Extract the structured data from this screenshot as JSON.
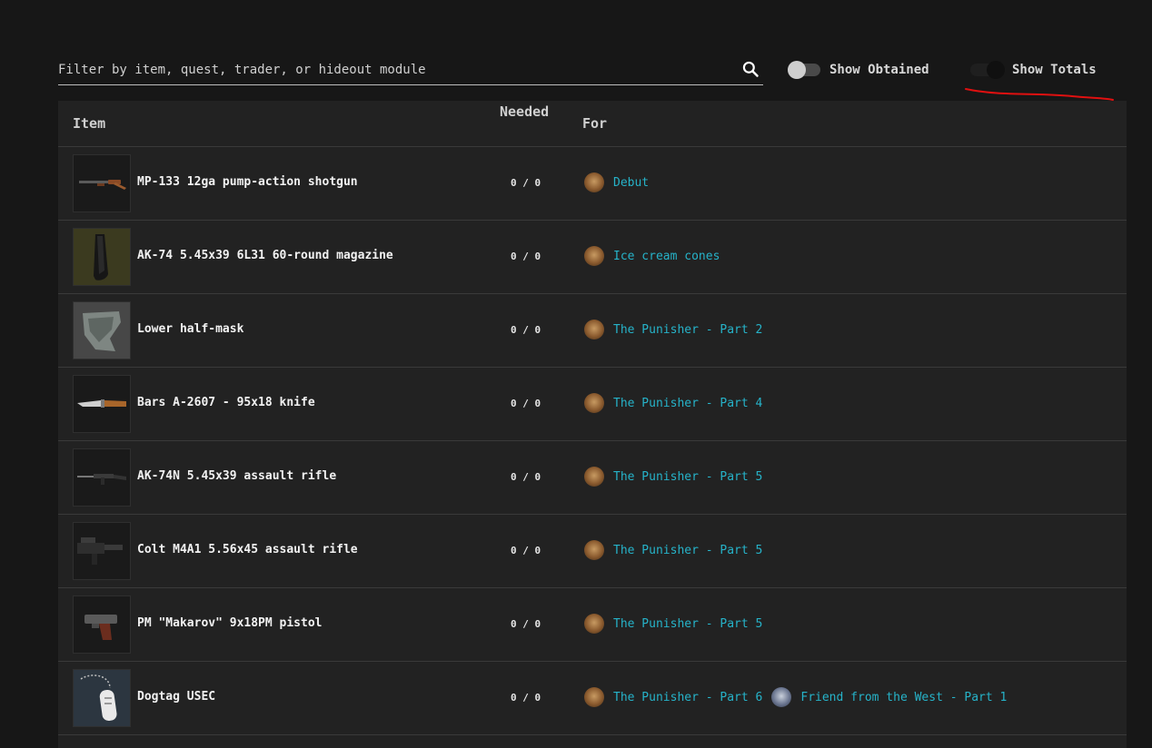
{
  "search": {
    "placeholder": "Filter by item, quest, trader, or hideout module",
    "value": ""
  },
  "toggles": [
    {
      "label": "Show Obtained",
      "on": false
    },
    {
      "label": "Show Totals",
      "on": true
    }
  ],
  "table": {
    "headers": {
      "item": "Item",
      "needed": "Needed",
      "for": "For"
    },
    "rows": [
      {
        "item": "MP-133 12ga pump-action shotgun",
        "icon": "shotgun-icon",
        "needed": "0 / 0",
        "quests": [
          {
            "trader": "prapor",
            "name": "Debut"
          }
        ]
      },
      {
        "item": "AK-74 5.45x39 6L31 60-round magazine",
        "icon": "magazine-icon",
        "needed": "0 / 0",
        "quests": [
          {
            "trader": "prapor",
            "name": "Ice cream cones"
          }
        ]
      },
      {
        "item": "Lower half-mask",
        "icon": "half-mask-icon",
        "needed": "0 / 0",
        "quests": [
          {
            "trader": "prapor",
            "name": "The Punisher - Part 2"
          }
        ]
      },
      {
        "item": "Bars A-2607 - 95x18 knife",
        "icon": "knife-icon",
        "needed": "0 / 0",
        "quests": [
          {
            "trader": "prapor",
            "name": "The Punisher - Part 4"
          }
        ]
      },
      {
        "item": "AK-74N 5.45x39 assault rifle",
        "icon": "rifle-icon",
        "needed": "0 / 0",
        "quests": [
          {
            "trader": "prapor",
            "name": "The Punisher - Part 5"
          }
        ]
      },
      {
        "item": "Colt M4A1 5.56x45 assault rifle",
        "icon": "m4-rifle-icon",
        "needed": "0 / 0",
        "quests": [
          {
            "trader": "prapor",
            "name": "The Punisher - Part 5"
          }
        ]
      },
      {
        "item": "PM \"Makarov\" 9x18PM pistol",
        "icon": "pistol-icon",
        "needed": "0 / 0",
        "quests": [
          {
            "trader": "prapor",
            "name": "The Punisher - Part 5"
          }
        ]
      },
      {
        "item": "Dogtag USEC",
        "icon": "dogtag-icon",
        "needed": "0 / 0",
        "quests": [
          {
            "trader": "prapor",
            "name": "The Punisher - Part 6"
          },
          {
            "trader": "peacekeeper",
            "name": "Friend from the West - Part 1"
          }
        ]
      }
    ]
  },
  "colors": {
    "accent_link": "#26b3c9",
    "annotation": "#e01010"
  }
}
